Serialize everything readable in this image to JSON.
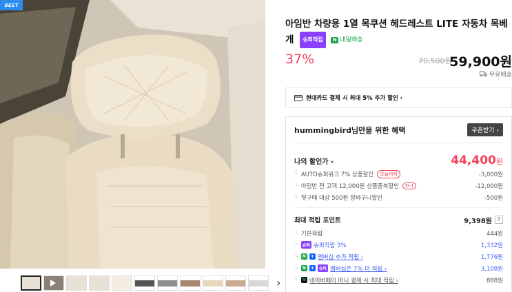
{
  "badge": {
    "best": "BEST"
  },
  "gallery": {
    "thumbnails": [
      "photo-1",
      "video",
      "photo-3",
      "photo-4",
      "photo-5",
      "swatch-dark",
      "swatch-gray",
      "swatch-brown",
      "swatch-cream",
      "swatch-beige",
      "swatch-light"
    ],
    "next_label": "›"
  },
  "product": {
    "title": "아임반 차량용 1열 목쿠션 헤드레스트 LITE 자동차 목베개",
    "super_badge": "슈퍼적립",
    "delivery_icon": "N",
    "delivery_label": "내일배송",
    "discount_rate": "37%",
    "original_price": "70,500원",
    "sale_price": "59,900원",
    "shipping": "무료배송"
  },
  "card_promo": {
    "text": "현대카드 결제 시 최대 5% 추가 할인 ›"
  },
  "benefit": {
    "title": "hummingbird님만을 위한 혜택",
    "coupon_button": "쿠폰받기 ›",
    "my_discount_label": "나의 할인가 ›",
    "my_discount_value": "44,400",
    "my_discount_unit": "원",
    "discounts": [
      {
        "label": "AUTO슈퍼위크 7% 상품할인",
        "tag": "오늘까지",
        "value": "-3,000원"
      },
      {
        "label": "아임반 전 고객 12,000원 상품중복할인",
        "tag": "D-1",
        "value": "-12,000원"
      },
      {
        "label": "첫구매 대상 500원 장바구니할인",
        "tag": "",
        "value": "-500원"
      }
    ],
    "points_label": "최대 적립 포인트",
    "points_value": "9,398원",
    "points_help": "?",
    "points": [
      {
        "badges": [],
        "label": "기본적립",
        "value": "444원"
      },
      {
        "badges": [
          "슈퍼"
        ],
        "label": "슈퍼적립 3%",
        "value": "1,332원"
      },
      {
        "badges": [
          "N",
          "+"
        ],
        "label": "멤버십 추가 적립 ›",
        "value": "1,776원"
      },
      {
        "badges": [
          "N",
          "+",
          "슈퍼"
        ],
        "label": "멤버십은 7% 더 적립 ›",
        "value": "3,108원"
      },
      {
        "badges": [
          "N"
        ],
        "label": "네이버페이 머니 결제 시 최대 적립 ›",
        "value": "888원"
      }
    ]
  },
  "colors": {
    "accent_red": "#f0445a",
    "super_purple": "#8a3ffc",
    "naver_green": "#15a34a",
    "link_blue": "#3f5cf5"
  }
}
